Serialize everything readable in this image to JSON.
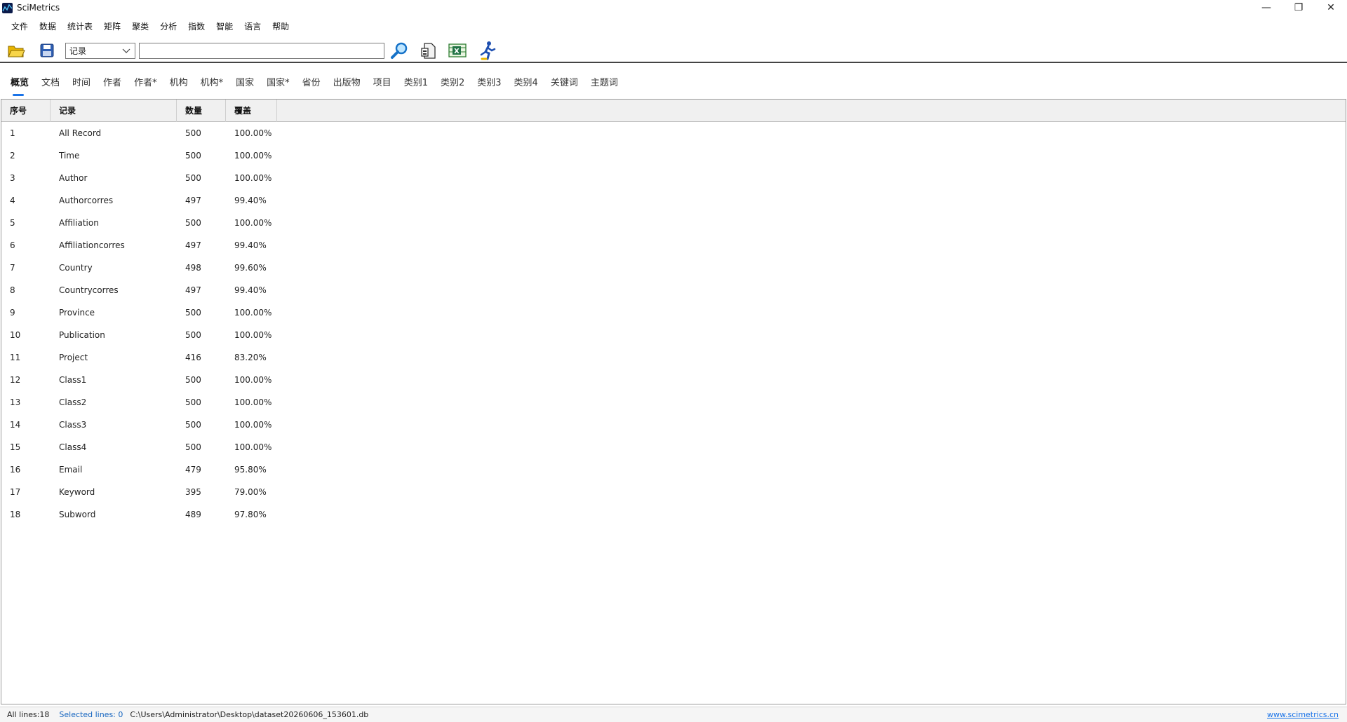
{
  "app": {
    "title": "SciMetrics"
  },
  "window_controls": {
    "minimize": "—",
    "maximize": "❐",
    "close": "✕"
  },
  "menu": [
    "文件",
    "数据",
    "统计表",
    "矩阵",
    "聚类",
    "分析",
    "指数",
    "智能",
    "语言",
    "帮助"
  ],
  "toolbar": {
    "open_icon": "folder-open-icon",
    "save_icon": "floppy-save-icon",
    "field_select": {
      "value": "记录"
    },
    "search_input": {
      "value": "",
      "placeholder": ""
    },
    "search_icon": "magnifier-icon",
    "export_icon": "document-export-icon",
    "excel_icon": "excel-icon",
    "run_icon": "running-person-icon"
  },
  "tabs": [
    "概览",
    "文档",
    "时间",
    "作者",
    "作者*",
    "机构",
    "机构*",
    "国家",
    "国家*",
    "省份",
    "出版物",
    "项目",
    "类别1",
    "类别2",
    "类别3",
    "类别4",
    "关键词",
    "主题词"
  ],
  "active_tab": "概览",
  "table": {
    "columns": [
      "序号",
      "记录",
      "数量",
      "覆盖"
    ],
    "rows": [
      [
        "1",
        "All Record",
        "500",
        "100.00%"
      ],
      [
        "2",
        "Time",
        "500",
        "100.00%"
      ],
      [
        "3",
        "Author",
        "500",
        "100.00%"
      ],
      [
        "4",
        "Authorcorres",
        "497",
        "99.40%"
      ],
      [
        "5",
        "Affiliation",
        "500",
        "100.00%"
      ],
      [
        "6",
        "Affiliationcorres",
        "497",
        "99.40%"
      ],
      [
        "7",
        "Country",
        "498",
        "99.60%"
      ],
      [
        "8",
        "Countrycorres",
        "497",
        "99.40%"
      ],
      [
        "9",
        "Province",
        "500",
        "100.00%"
      ],
      [
        "10",
        "Publication",
        "500",
        "100.00%"
      ],
      [
        "11",
        "Project",
        "416",
        "83.20%"
      ],
      [
        "12",
        "Class1",
        "500",
        "100.00%"
      ],
      [
        "13",
        "Class2",
        "500",
        "100.00%"
      ],
      [
        "14",
        "Class3",
        "500",
        "100.00%"
      ],
      [
        "15",
        "Class4",
        "500",
        "100.00%"
      ],
      [
        "16",
        "Email",
        "479",
        "95.80%"
      ],
      [
        "17",
        "Keyword",
        "395",
        "79.00%"
      ],
      [
        "18",
        "Subword",
        "489",
        "97.80%"
      ]
    ]
  },
  "status": {
    "all_lines": "All lines:18",
    "selected_lines": "Selected lines: 0",
    "path": "C:\\Users\\Administrator\\Desktop\\dataset20260606_153601.db",
    "website": "www.scimetrics.cn"
  },
  "colors": {
    "accent": "#1a73e8",
    "status_blue": "#1565c0",
    "header_bg": "#f0f0f0"
  }
}
